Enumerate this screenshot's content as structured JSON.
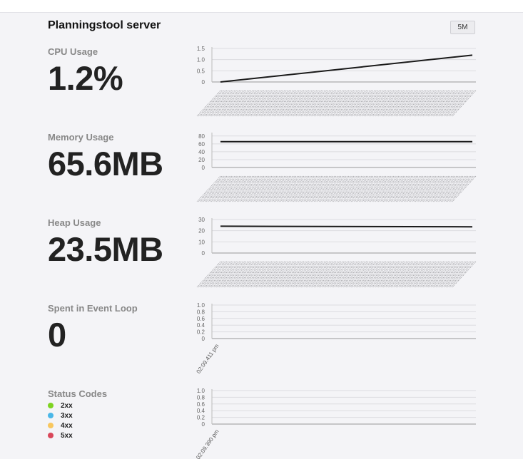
{
  "header": {
    "title": "Planningstool server",
    "period_button": "5M"
  },
  "metrics": {
    "cpu": {
      "label": "CPU Usage",
      "value": "1.2%"
    },
    "memory": {
      "label": "Memory Usage",
      "value": "65.6MB"
    },
    "heap": {
      "label": "Heap Usage",
      "value": "23.5MB"
    },
    "event_loop": {
      "label": "Spent in Event Loop",
      "value": "0"
    },
    "status_codes": {
      "label": "Status Codes",
      "legend": [
        {
          "label": "2xx",
          "color": "#7ed321"
        },
        {
          "label": "3xx",
          "color": "#4ab7e8"
        },
        {
          "label": "4xx",
          "color": "#f8c75e"
        },
        {
          "label": "5xx",
          "color": "#d9475a"
        }
      ]
    }
  },
  "chart_data": [
    {
      "type": "line",
      "title": "CPU Usage",
      "y_ticks": [
        "1.5",
        "1.0",
        "0.5",
        "0"
      ],
      "ylim": [
        0,
        1.5
      ],
      "series": [
        {
          "values": [
            0,
            1.2
          ]
        }
      ],
      "x_axis_labels": "dense, overlapping, illegible",
      "grid": true
    },
    {
      "type": "line",
      "title": "Memory Usage",
      "y_ticks": [
        "80",
        "60",
        "40",
        "20",
        "0"
      ],
      "ylim": [
        0,
        85
      ],
      "series": [
        {
          "values": [
            65.6,
            65.6
          ]
        }
      ],
      "x_axis_labels": "dense, overlapping, illegible",
      "grid": true
    },
    {
      "type": "line",
      "title": "Heap Usage",
      "y_ticks": [
        "30",
        "20",
        "10",
        "0"
      ],
      "ylim": [
        0,
        30
      ],
      "series": [
        {
          "values": [
            24,
            23.5
          ]
        }
      ],
      "x_axis_labels": "dense, overlapping, illegible",
      "grid": true
    },
    {
      "type": "line",
      "title": "Spent in Event Loop",
      "y_ticks": [
        "1.0",
        "0.8",
        "0.6",
        "0.4",
        "0.2",
        "0"
      ],
      "ylim": [
        0,
        1
      ],
      "x_labels": [
        "02:09.411 pm"
      ],
      "series": [],
      "grid": true
    },
    {
      "type": "line",
      "title": "Status Codes",
      "y_ticks": [
        "1.0",
        "0.8",
        "0.6",
        "0.4",
        "0.2",
        "0"
      ],
      "ylim": [
        0,
        1
      ],
      "x_labels": [
        "02:09.390 pm"
      ],
      "series": [],
      "grid": true
    }
  ]
}
